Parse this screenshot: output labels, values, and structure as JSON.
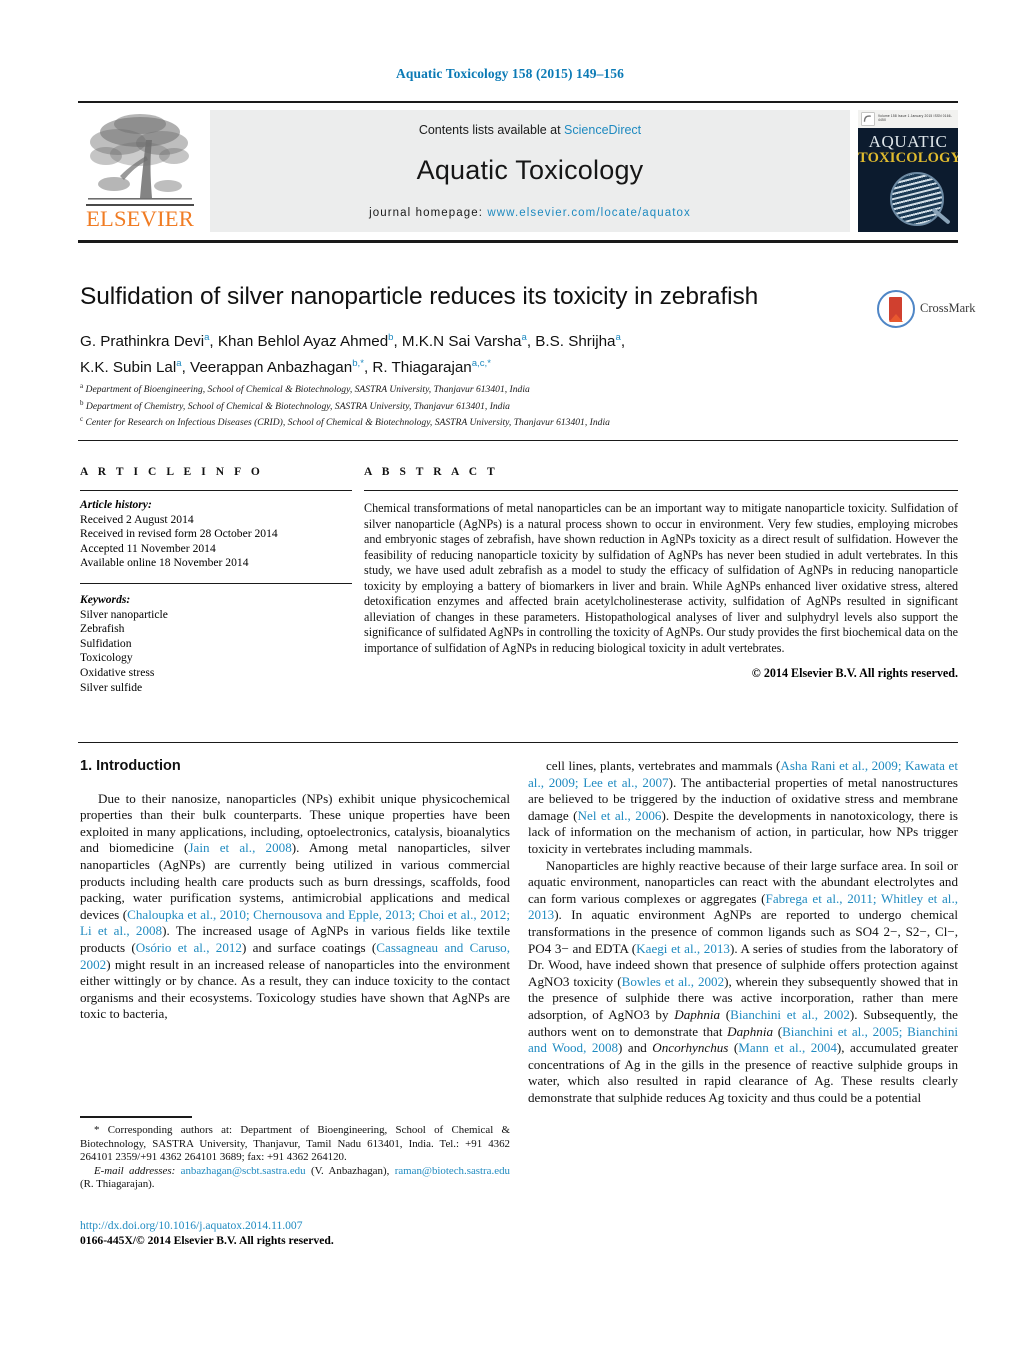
{
  "running_head": "Aquatic Toxicology 158 (2015) 149–156",
  "masthead": {
    "elsevier_wordmark": "ELSEVIER",
    "contents_prefix": "Contents lists available at ",
    "contents_link": "ScienceDirect",
    "journal_title": "Aquatic Toxicology",
    "homepage_prefix": "journal homepage: ",
    "homepage_url": "www.elsevier.com/locate/aquatox",
    "cover": {
      "line1": "AQUATIC",
      "line2": "TOXICOLOGY",
      "top_strip_text": "Volume 158 Issue 1 January 2015   ISSN 0166-445X"
    }
  },
  "article": {
    "title": "Sulfidation of silver nanoparticle reduces its toxicity in zebrafish",
    "crossmark_label": "CrossMark",
    "authors_line1": "G. Prathinkra Devi a, Khan Behlol Ayaz Ahmed b, M.K.N Sai Varsha a, B.S. Shrijha a,",
    "authors_line2": "K.K. Subin Lal a, Veerappan Anbazhagan b,*, R. Thiagarajan a,c,*",
    "authors": [
      {
        "name": "G. Prathinkra Devi",
        "marks": "a"
      },
      {
        "name": "Khan Behlol Ayaz Ahmed",
        "marks": "b"
      },
      {
        "name": "M.K.N Sai Varsha",
        "marks": "a"
      },
      {
        "name": "B.S. Shrijha",
        "marks": "a"
      },
      {
        "name": "K.K. Subin Lal",
        "marks": "a"
      },
      {
        "name": "Veerappan Anbazhagan",
        "marks": "b,*"
      },
      {
        "name": "R. Thiagarajan",
        "marks": "a,c,*"
      }
    ],
    "affiliations": [
      {
        "mark": "a",
        "text": "Department of Bioengineering, School of Chemical & Biotechnology, SASTRA University, Thanjavur 613401, India"
      },
      {
        "mark": "b",
        "text": "Department of Chemistry, School of Chemical & Biotechnology, SASTRA University, Thanjavur 613401, India"
      },
      {
        "mark": "c",
        "text": "Center for Research on Infectious Diseases (CRID), School of Chemical & Biotechnology, SASTRA University, Thanjavur 613401, India"
      }
    ]
  },
  "article_info": {
    "heading": "A R T I C L E   I N F O",
    "history_label": "Article history:",
    "history": [
      "Received 2 August 2014",
      "Received in revised form 28 October 2014",
      "Accepted 11 November 2014",
      "Available online 18 November 2014"
    ],
    "keywords_label": "Keywords:",
    "keywords": [
      "Silver nanoparticle",
      "Zebrafish",
      "Sulfidation",
      "Toxicology",
      "Oxidative stress",
      "Silver sulfide"
    ]
  },
  "abstract": {
    "heading": "A B S T R A C T",
    "text": "Chemical transformations of metal nanoparticles can be an important way to mitigate nanoparticle toxicity. Sulfidation of silver nanoparticle (AgNPs) is a natural process shown to occur in environment. Very few studies, employing microbes and embryonic stages of zebrafish, have shown reduction in AgNPs toxicity as a direct result of sulfidation. However the feasibility of reducing nanoparticle toxicity by sulfidation of AgNPs has never been studied in adult vertebrates. In this study, we have used adult zebrafish as a model to study the efficacy of sulfidation of AgNPs in reducing nanoparticle toxicity by employing a battery of biomarkers in liver and brain. While AgNPs enhanced liver oxidative stress, altered detoxification enzymes and affected brain acetylcholinesterase activity, sulfidation of AgNPs resulted in significant alleviation of changes in these parameters. Histopathological analyses of liver and sulphydryl levels also support the significance of sulfidated AgNPs in controlling the toxicity of AgNPs. Our study provides the first biochemical data on the importance of sulfidation of AgNPs in reducing biological toxicity in adult vertebrates.",
    "copyright": "© 2014 Elsevier B.V. All rights reserved."
  },
  "body": {
    "section_number_title": "1.  Introduction",
    "left_paragraph_1_a": "Due to their nanosize, nanoparticles (NPs) exhibit unique physicochemical properties than their bulk counterparts. These unique properties have been exploited in many applications, including, optoelectronics, catalysis, bioanalytics and biomedicine (",
    "left_ref_1": "Jain et al., 2008",
    "left_paragraph_1_b": "). Among metal nanoparticles, silver nanoparticles (AgNPs) are currently being utilized in various commercial products including health care products such as burn dressings, scaffolds, food packing, water purification systems, antimicrobial applications and medical devices (",
    "left_ref_2": "Chaloupka et al., 2010; Chernousova and Epple, 2013; Choi et al., 2012; Li et al., 2008",
    "left_paragraph_1_c": "). The increased usage of AgNPs in various fields like textile products (",
    "left_ref_3": "Osório et al., 2012",
    "left_paragraph_1_d": ") and surface coatings (",
    "left_ref_4": "Cassagneau and Caruso, 2002",
    "left_paragraph_1_e": ") might result in an increased release of nanoparticles into the environment either wittingly or by chance. As a result, they can induce toxicity to the contact organisms and their ecosystems. Toxicology studies have shown that AgNPs are toxic to bacteria,",
    "right_paragraph_1_a": "cell lines, plants, vertebrates and mammals (",
    "right_ref_1": "Asha Rani et al., 2009; Kawata et al., 2009; Lee et al., 2007",
    "right_paragraph_1_b": "). The antibacterial properties of metal nanostructures are believed to be triggered by the induction of oxidative stress and membrane damage (",
    "right_ref_2": "Nel et al., 2006",
    "right_paragraph_1_c": "). Despite the developments in nanotoxicology, there is lack of information on the mechanism of action, in particular, how NPs trigger toxicity in vertebrates including mammals.",
    "right_paragraph_2_a": "Nanoparticles are highly reactive because of their large surface area. In soil or aquatic environment, nanoparticles can react with the abundant electrolytes and can form various complexes or aggregates (",
    "right_ref_3": "Fabrega et al., 2011; Whitley et al., 2013",
    "right_paragraph_2_b": "). In aquatic environment AgNPs are reported to undergo chemical transformations in the presence of common ligands such as SO4 2−, S2−, Cl−, PO4 3− and EDTA (",
    "right_ref_4": "Kaegi et al., 2013",
    "right_paragraph_2_c": "). A series of studies from the laboratory of Dr. Wood, have indeed shown that presence of sulphide offers protection against AgNO3 toxicity (",
    "right_ref_5": "Bowles et al., 2002",
    "right_paragraph_2_d": "), wherein they subsequently showed that in the presence of sulphide there was active incorporation, rather than mere adsorption, of AgNO3 by ",
    "right_italic_1": "Daphnia",
    "right_paragraph_2_e": " (",
    "right_ref_6": "Bianchini et al., 2002",
    "right_paragraph_2_f": "). Subsequently, the authors went on to demonstrate that ",
    "right_italic_2": "Daphnia",
    "right_paragraph_2_g": " (",
    "right_ref_7": "Bianchini et al., 2005; Bianchini and Wood, 2008",
    "right_paragraph_2_h": ") and ",
    "right_italic_3": "Oncorhynchus",
    "right_paragraph_2_i": " (",
    "right_ref_8": "Mann et al., 2004",
    "right_paragraph_2_j": "), accumulated greater concentrations of Ag in the gills in the presence of reactive sulphide groups in water, which also resulted in rapid clearance of Ag. These results clearly demonstrate that sulphide reduces Ag toxicity and thus could be a potential"
  },
  "footnote": {
    "corresponding": "* Corresponding authors at: Department of Bioengineering, School of Chemical & Biotechnology, SASTRA University, Thanjavur, Tamil Nadu 613401, India. Tel.: +91 4362 264101 2359/+91 4362 264101 3689; fax: +91 4362 264120.",
    "email_label": "E-mail addresses:",
    "email_1": "anbazhagan@scbt.sastra.edu",
    "email_1_owner": "(V. Anbazhagan),",
    "email_2": "raman@biotech.sastra.edu",
    "email_2_owner": "(R. Thiagarajan).",
    "doi": "http://dx.doi.org/10.1016/j.aquatox.2014.11.007",
    "issn": "0166-445X/© 2014 Elsevier B.V. All rights reserved."
  },
  "colors": {
    "link_blue": "#1f8ac0",
    "elsevier_orange": "#f07c24",
    "band_gray": "#eceded",
    "cover_navy": "#0c1b2e",
    "cover_yellow": "#e0bb2e"
  }
}
